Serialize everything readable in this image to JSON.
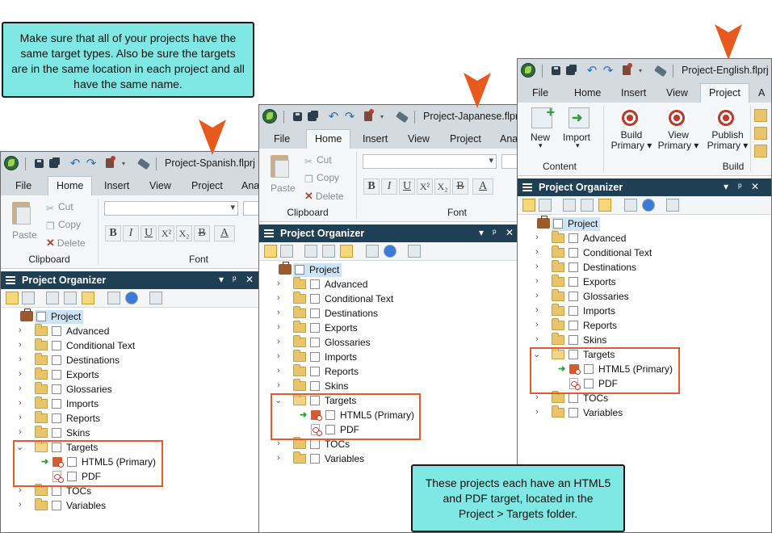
{
  "callouts": {
    "top_left": "Make sure that all of your projects have the same target types. Also be sure the targets are in the same location in each project and all have the same name.",
    "bottom_right": "These projects each have an HTML5 and PDF target, located in the Project > Targets folder."
  },
  "colors": {
    "callout_bg": "#7fe8e4",
    "pointer": "#e8591e",
    "organizer_header": "#1f3f55",
    "highlight_box": "#e35a2b",
    "selection": "#cde4f7"
  },
  "windows": {
    "spanish": {
      "title": "Project-Spanish.flprj -",
      "menu": [
        "File",
        "Home",
        "Insert",
        "View",
        "Project",
        "Ana"
      ],
      "active_menu": "Home",
      "ribbon": {
        "paste": "Paste",
        "cut": "Cut",
        "copy": "Copy",
        "delete": "Delete",
        "clipboard_label": "Clipboard",
        "font_label": "Font"
      },
      "organizer": {
        "title": "Project Organizer",
        "controls": [
          "▾",
          "📌",
          "✕"
        ],
        "root": "Project",
        "folders": [
          "Advanced",
          "Conditional Text",
          "Destinations",
          "Exports",
          "Glossaries",
          "Imports",
          "Reports",
          "Skins",
          "Targets"
        ],
        "targets": [
          "HTML5 (Primary)",
          "PDF"
        ],
        "after": [
          "TOCs",
          "Variables"
        ]
      }
    },
    "japanese": {
      "title": "Project-Japanese.flprj",
      "menu": [
        "File",
        "Home",
        "Insert",
        "View",
        "Project",
        "Ana"
      ],
      "active_menu": "Home",
      "ribbon": {
        "paste": "Paste",
        "cut": "Cut",
        "copy": "Copy",
        "delete": "Delete",
        "clipboard_label": "Clipboard",
        "font_label": "Font"
      },
      "organizer": {
        "title": "Project Organizer",
        "root": "Project",
        "folders": [
          "Advanced",
          "Conditional Text",
          "Destinations",
          "Exports",
          "Glossaries",
          "Imports",
          "Reports",
          "Skins",
          "Targets"
        ],
        "targets": [
          "HTML5 (Primary)",
          "PDF"
        ],
        "after": [
          "TOCs",
          "Variables"
        ]
      }
    },
    "english": {
      "title": "Project-English.flprj",
      "menu": [
        "File",
        "Home",
        "Insert",
        "View",
        "Project",
        "A"
      ],
      "active_menu": "Project",
      "ribbon": {
        "new": "New",
        "import": "Import",
        "content_label": "Content",
        "build_primary": "Build\nPrimary ▾",
        "view_primary": "View\nPrimary ▾",
        "publish_primary": "Publish\nPrimary ▾",
        "build_label": "Build"
      },
      "organizer": {
        "title": "Project Organizer",
        "root": "Project",
        "folders": [
          "Advanced",
          "Conditional Text",
          "Destinations",
          "Exports",
          "Glossaries",
          "Imports",
          "Reports",
          "Skins",
          "Targets"
        ],
        "targets": [
          "HTML5 (Primary)",
          "PDF"
        ],
        "after": [
          "TOCs",
          "Variables"
        ]
      }
    }
  },
  "font_buttons": [
    "B",
    "I",
    "U",
    "X²",
    "X₂",
    "B",
    "A"
  ]
}
